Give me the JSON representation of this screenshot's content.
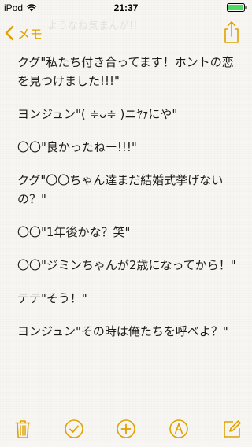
{
  "status_bar": {
    "carrier": "iPod",
    "time": "21:37"
  },
  "nav": {
    "back_label": "メモ",
    "ghost_text": "ようなね気まんが!!"
  },
  "note": {
    "lines": [
      "クグ\"私たち付き合ってます！ホントの恋を見つけました!!!\"",
      "ヨンジュン\"( ≑ᴗ≑ )ニﾔｧにや\"",
      "〇〇\"良かったねー!!!\"",
      "クグ\"〇〇ちゃん達まだ結婚式挙げないの？\"",
      "〇〇\"1年後かな？笑\"",
      "〇〇\"ジミンちゃんが2歳になってから！\"",
      "テテ\"そう！\"",
      "ヨンジュン\"その時は俺たちを呼べよ？\""
    ]
  },
  "colors": {
    "accent": "#e0a200",
    "battery": "#4cd964"
  },
  "icons": {
    "back": "chevron-left-icon",
    "share": "share-icon",
    "trash": "trash-icon",
    "checklist": "checkmark-circle-icon",
    "add": "plus-circle-icon",
    "markup": "markup-pen-icon",
    "compose": "compose-icon"
  }
}
